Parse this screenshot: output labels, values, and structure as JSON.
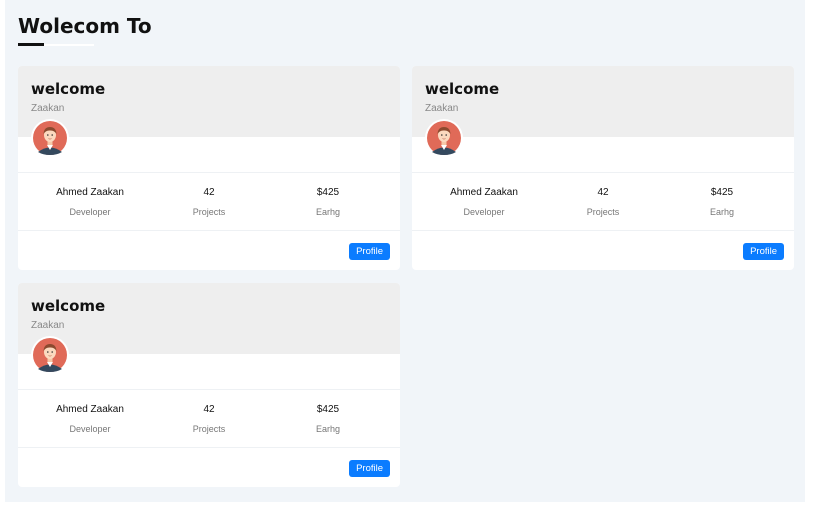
{
  "page": {
    "title": "Wolecom To"
  },
  "colors": {
    "accent": "#0b7cff",
    "card_header": "#eeeeee",
    "page_background": "#f1f5f9"
  },
  "cards": [
    {
      "heading": "welcome",
      "subtitle": "Zaakan",
      "stats": [
        {
          "value": "Ahmed Zaakan",
          "label": "Developer"
        },
        {
          "value": "42",
          "label": "Projects"
        },
        {
          "value": "$425",
          "label": "Earhg"
        }
      ],
      "button_label": "Profile"
    },
    {
      "heading": "welcome",
      "subtitle": "Zaakan",
      "stats": [
        {
          "value": "Ahmed Zaakan",
          "label": "Developer"
        },
        {
          "value": "42",
          "label": "Projects"
        },
        {
          "value": "$425",
          "label": "Earhg"
        }
      ],
      "button_label": "Profile"
    },
    {
      "heading": "welcome",
      "subtitle": "Zaakan",
      "stats": [
        {
          "value": "Ahmed Zaakan",
          "label": "Developer"
        },
        {
          "value": "42",
          "label": "Projects"
        },
        {
          "value": "$425",
          "label": "Earhg"
        }
      ],
      "button_label": "Profile"
    }
  ]
}
